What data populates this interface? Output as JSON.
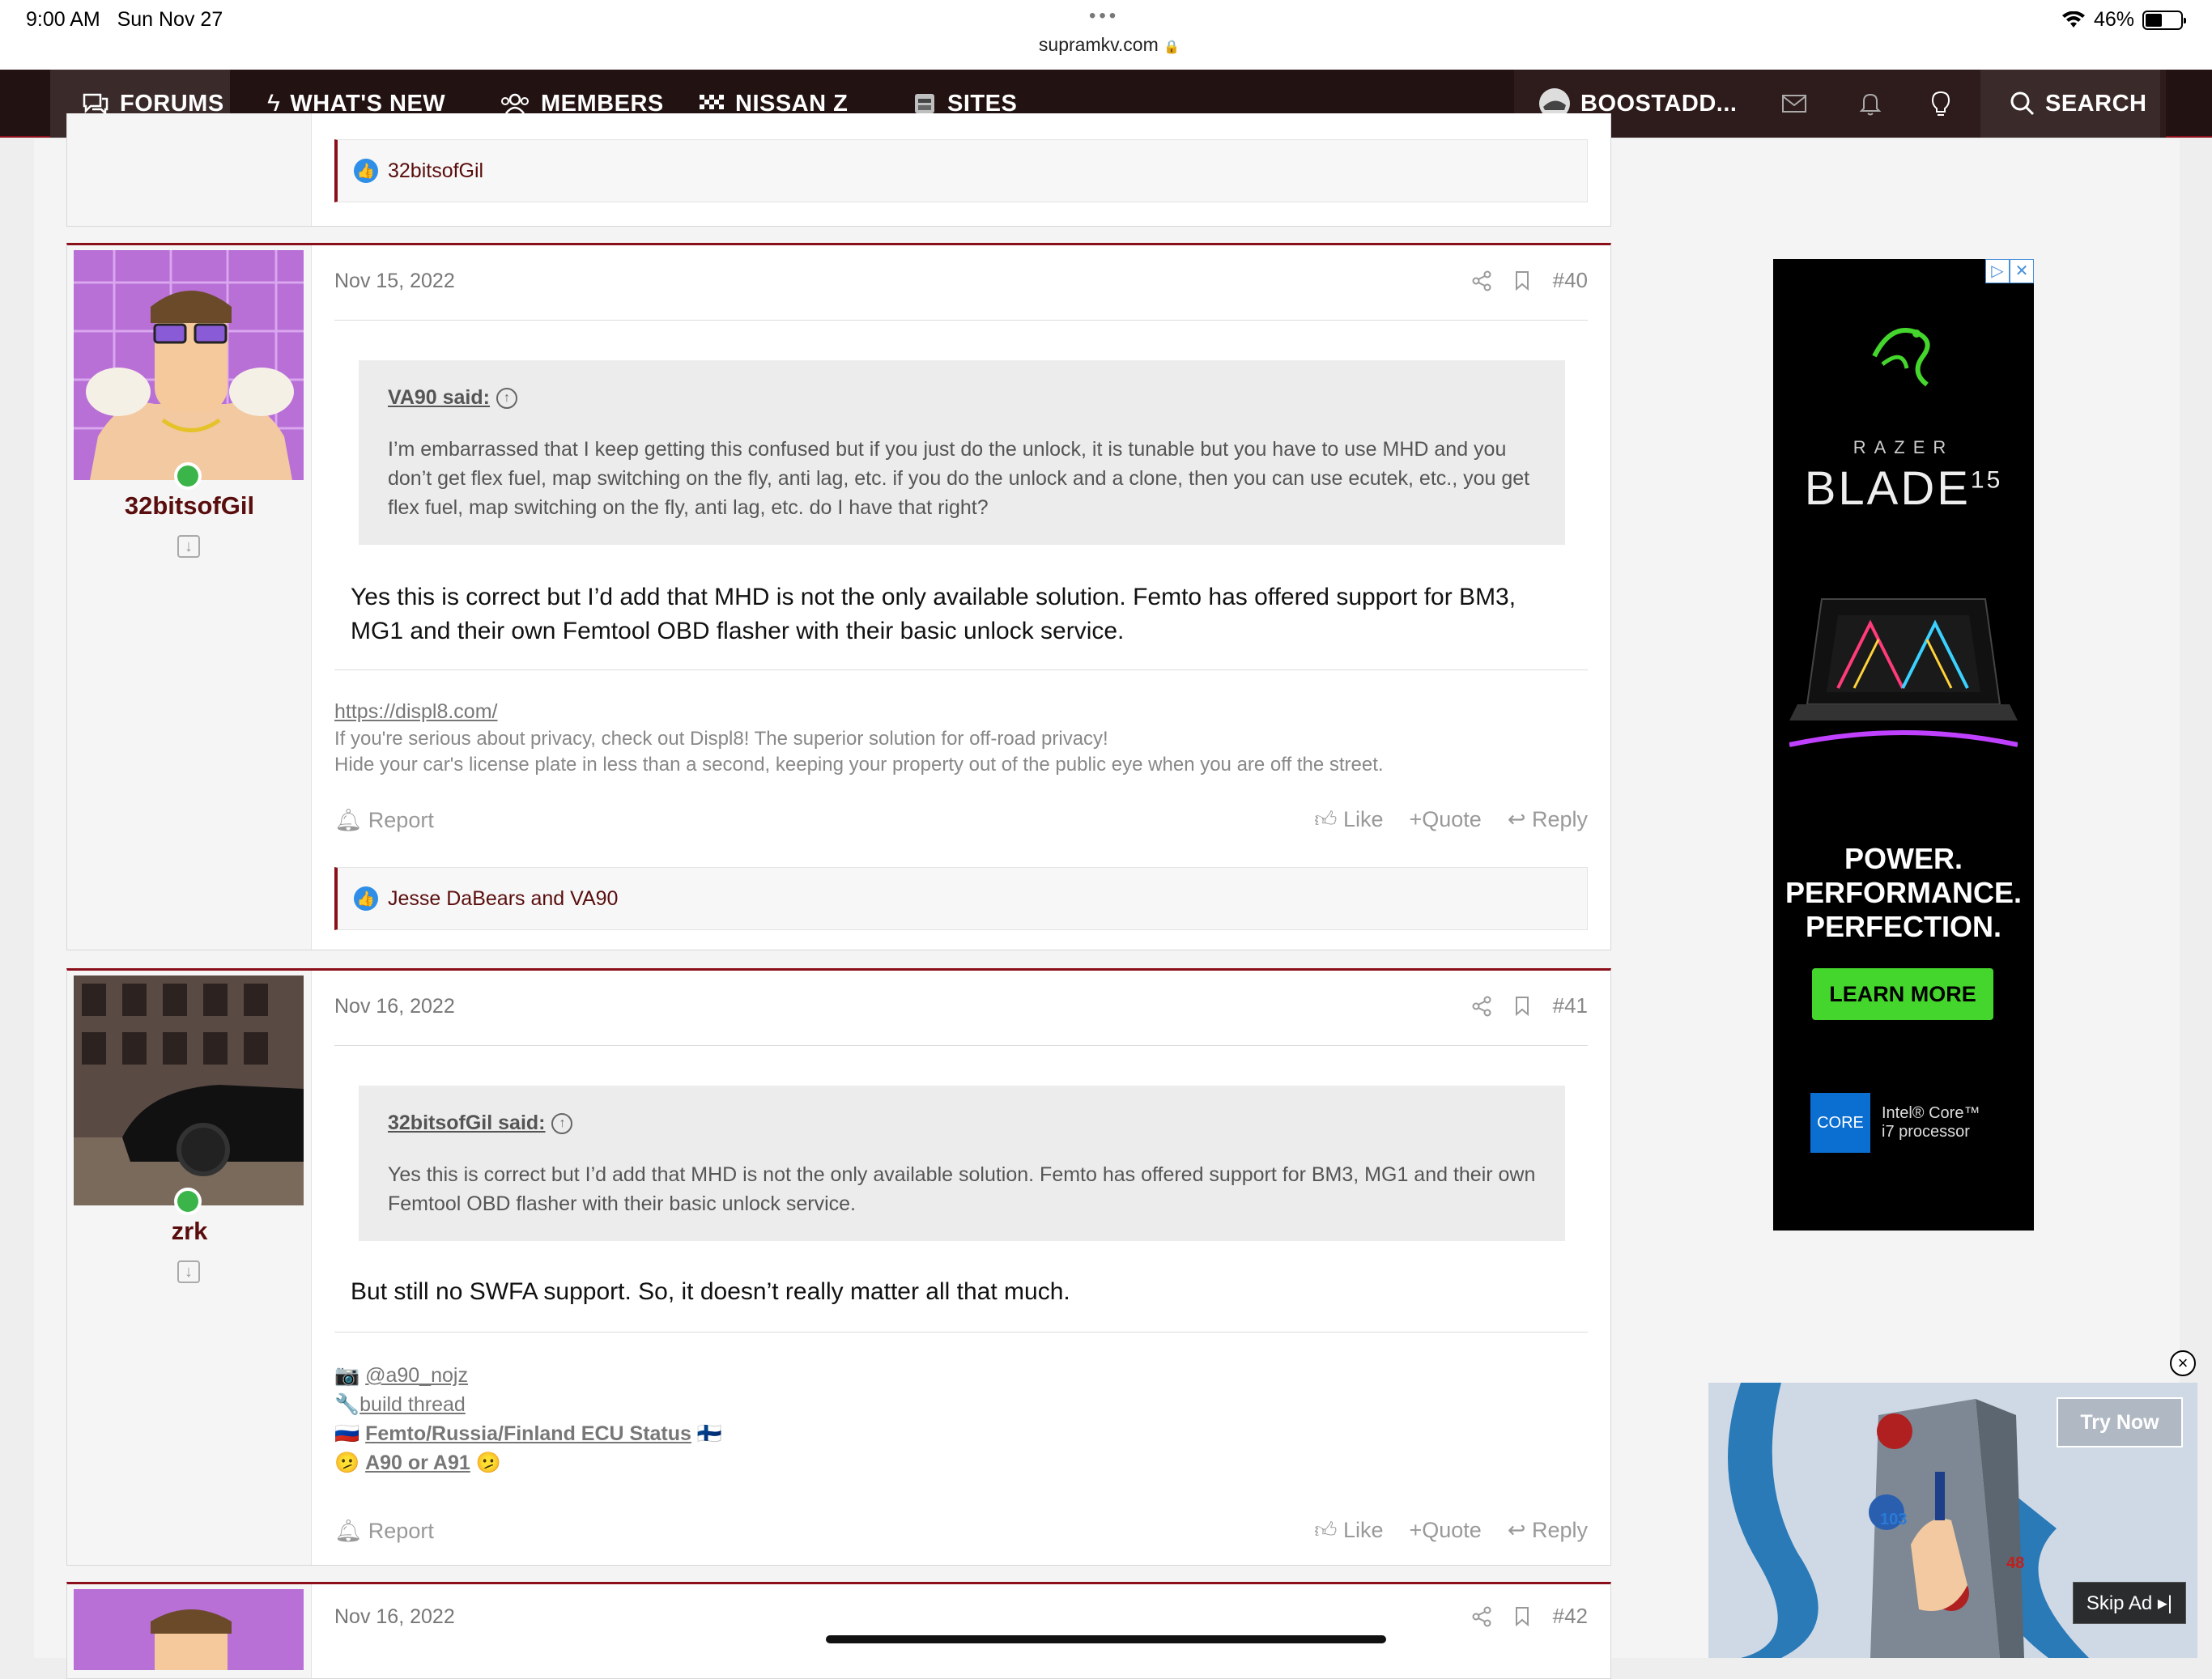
{
  "status_bar": {
    "time": "9:00 AM",
    "date": "Sun Nov 27",
    "url": "supramkv.com",
    "battery": "46%",
    "lock_glyph": "🔒"
  },
  "nav": {
    "items": [
      {
        "label": "FORUMS",
        "icon": "chat-icon"
      },
      {
        "label": "WHAT'S NEW",
        "icon": "bolt-icon"
      },
      {
        "label": "MEMBERS",
        "icon": "users-icon"
      },
      {
        "label": "NISSAN Z",
        "icon": "checkered-flag-icon"
      },
      {
        "label": "SITES",
        "icon": "site-icon"
      }
    ],
    "account": "BOOSTADD...",
    "search": "SEARCH"
  },
  "prev_post": {
    "reaction_text": "32bitsofGil"
  },
  "posts": [
    {
      "date": "Nov 15, 2022",
      "number": "#40",
      "username": "32bitsofGil",
      "quote_author": "VA90 said:",
      "quote_text": "I’m embarrassed that I keep getting this confused but if you just do the unlock, it is tunable but you have to use MHD and you don’t get flex fuel, map switching on the fly, anti lag, etc. if you do the unlock and a clone, then you can use ecutek, etc., you get flex fuel, map switching on the fly, anti lag, etc. do I have that right?",
      "body": "Yes this is correct but I’d add that MHD is not the only available solution. Femto has offered support for BM3, MG1 and their own Femtool OBD flasher with their basic unlock service.",
      "sig_link": "https://displ8.com/",
      "sig_line1": "If you're serious about privacy, check out Displ8! The superior solution for off-road privacy!",
      "sig_line2": "Hide your car's license plate in less than a second, keeping your property out of the public eye when you are off the street.",
      "report": "Report",
      "like": "Like",
      "quote": "Quote",
      "reply": "Reply",
      "reactions": "Jesse DaBears and VA90"
    },
    {
      "date": "Nov 16, 2022",
      "number": "#41",
      "username": "zrk",
      "quote_author": "32bitsofGil said:",
      "quote_text": "Yes this is correct but I’d add that MHD is not the only available solution. Femto has offered support for BM3, MG1 and their own Femtool OBD flasher with their basic unlock service.",
      "body": "But still no SWFA support. So, it doesn’t really matter all that much.",
      "sig_instagram": "@a90_nojz",
      "sig_build": "build thread",
      "sig_femto": "Femto/Russia/Finland ECU Status",
      "sig_a90": "A90 or A91",
      "report": "Report",
      "like": "Like",
      "quote": "Quote",
      "reply": "Reply"
    },
    {
      "date": "Nov 16, 2022",
      "number": "#42"
    }
  ],
  "ad": {
    "brand": "RAZER",
    "product": "BLADE",
    "product_sup": "15",
    "tagline": "POWER. PERFORMANCE. PERFECTION.",
    "cta": "LEARN MORE",
    "intel_badge": "CORE",
    "intel_text": "Intel® Core™ i7 processor"
  },
  "video_ad": {
    "try_now": "Try Now",
    "skip": "Skip Ad ▸|",
    "num_a": "103",
    "num_b": "48"
  },
  "colors": {
    "accent": "#8b0f1a",
    "nav_bg": "#231212",
    "username": "#5a0d0d",
    "online": "#3bb54a",
    "like": "#2f8fe8",
    "razer_green": "#44d62c"
  }
}
